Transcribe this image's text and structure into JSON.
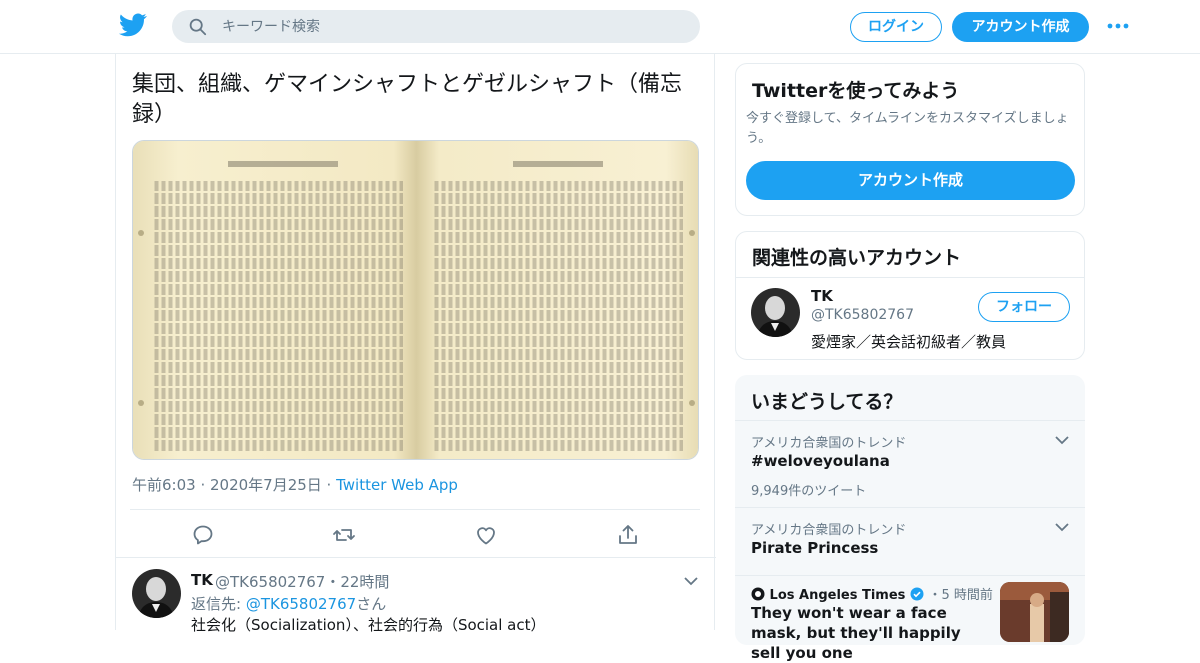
{
  "header": {
    "search_placeholder": "キーワード検索",
    "login_label": "ログイン",
    "signup_label": "アカウント作成"
  },
  "tweet": {
    "text": "集団、組織、ゲマインシャフトとゲゼルシャフト（備忘録）",
    "time": "午前6:03 · 2020年7月25日 · ",
    "app": "Twitter Web App"
  },
  "reply": {
    "name": "TK",
    "handle": "@TK65802767・22時間",
    "replyto_prefix": "返信先: ",
    "replyto_handle": "@TK65802767",
    "replyto_suffix": "さん",
    "text": "社会化（Socialization）、社会的行為（Social act）"
  },
  "signup_card": {
    "title": "Twitterを使ってみよう",
    "description": "今すぐ登録して、タイムラインをカスタマイズしましょう。",
    "button": "アカウント作成"
  },
  "related_card": {
    "title": "関連性の高いアカウント",
    "name": "TK",
    "handle": "@TK65802767",
    "bio": "愛煙家／英会話初級者／教員",
    "follow_label": "フォロー"
  },
  "trends": {
    "title": "いまどうしてる？",
    "items": [
      {
        "context": "アメリカ合衆国のトレンド",
        "topic": "#weloveyoulana",
        "count": "9,949件のツイート"
      },
      {
        "context": "アメリカ合衆国のトレンド",
        "topic": "Pirate Princess",
        "count": ""
      }
    ],
    "news": {
      "source": "Los Angeles Times",
      "time": "・5 時間前",
      "headline": "They won't wear a face mask, but they'll happily sell you one"
    }
  },
  "colors": {
    "accent": "#1da1f2",
    "link": "#1b95e0",
    "muted": "#657786"
  }
}
